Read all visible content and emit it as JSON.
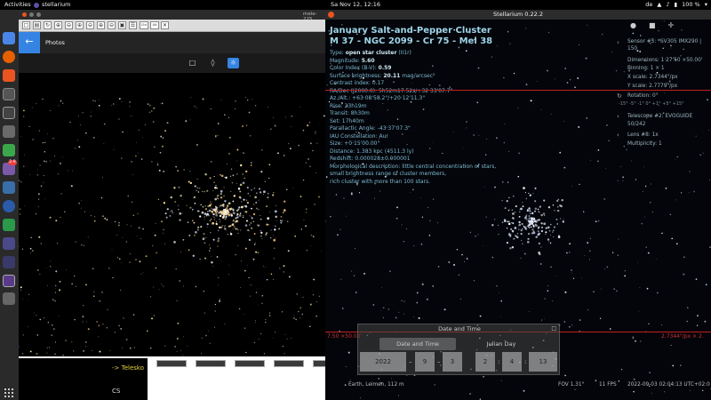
{
  "topbar": {
    "activities": "Activities",
    "app_name": "stellarium",
    "clock": "Sa Nov 12, 12:16",
    "lang": "de",
    "battery": "100 %"
  },
  "dock": {
    "badge_count": "2.9"
  },
  "viewer": {
    "title": "mele-225 [zoom",
    "toolbar_buttons": [
      "□",
      "▤",
      "↻",
      "⊕",
      "⊖",
      "⊕",
      "⊖",
      "⊕",
      "⊖",
      "▣",
      "☰",
      "Ctrl",
      "Alt",
      "✕"
    ],
    "photos_title": "Photos",
    "terminal_line": "-> Telesko",
    "terminal_prompt": "CS"
  },
  "stellarium": {
    "window_title": "Stellarium 0.22.2",
    "object_name_1": "January Salt-and-Pepper Cluster",
    "object_name_2": "M 37 - NGC 2099 - Cr 75 - Mel 38",
    "info_lines": [
      {
        "label": "Type: ",
        "value": "open star cluster",
        "tail": " (II1r)"
      },
      {
        "label": "Magnitude: ",
        "value": "5.60",
        "tail": ""
      },
      {
        "label": "Color Index (B-V): ",
        "value": "0.59",
        "tail": ""
      },
      {
        "label": "Surface brightness: ",
        "value": "20.11",
        "tail": " mag/arcsec²"
      },
      {
        "label": "Contrast index: 0.17",
        "value": "",
        "tail": ""
      },
      {
        "label": "RA/Dec (J2000.0): 5h52m17.52s/+32·33'07.7\"",
        "value": "",
        "tail": ""
      },
      {
        "label": "Az./Alt.:              +63·08'58.2\"/+20·12'11.3\"",
        "value": "",
        "tail": ""
      },
      {
        "label": "Rise:    23h19m",
        "value": "",
        "tail": ""
      },
      {
        "label": "Transit:  8h30m",
        "value": "",
        "tail": ""
      },
      {
        "label": "Set:      17h40m",
        "value": "",
        "tail": ""
      },
      {
        "label": "Parallactic Angle: -43·37'07.3\"",
        "value": "",
        "tail": ""
      },
      {
        "label": "IAU Constellation: Aur",
        "value": "",
        "tail": ""
      },
      {
        "label": "Size: +0·15'00.00\"",
        "value": "",
        "tail": ""
      },
      {
        "label": "Distance: 1.383 kpc (4511.3 ly)",
        "value": "",
        "tail": ""
      },
      {
        "label": "Redshift: 0.000028±0.000001",
        "value": "",
        "tail": ""
      },
      {
        "label": "Morphological description: little central concentration of stars,",
        "value": "",
        "tail": ""
      },
      {
        "label": "small brightness range of cluster members,",
        "value": "",
        "tail": ""
      },
      {
        "label": "rich cluster with more than 100 stars.",
        "value": "",
        "tail": ""
      }
    ],
    "ocular": {
      "sensor": "Sensor #5: *SV305 IMX290 |",
      "sensor_2": "150",
      "dimensions": "Dimensions: 1·27'50 ×50.00'",
      "binning": "Binning: 1 × 1",
      "x_scale": "X scale: 2.7344\"/px",
      "y_scale": "Y scale: 2.7779\"/px",
      "rotation": "Rotation: 0°",
      "rotation_scale": "-15° -5° -1°  0°  +1° +5° +15°",
      "telescope": "Telescope #2: EVOGUIDE",
      "telescope_2": "50/242",
      "lens": "Lens #8: 1x",
      "multiplicity": "Multiplicity: 1"
    },
    "red_left": "7.50 ×50.00'",
    "red_right": "2.7344\"/px × 2.",
    "datetime": {
      "dialog_title": "Date and Time",
      "tab_date": "Date and Time",
      "tab_julian": "Julian Day",
      "year": "2022",
      "month": "9",
      "day": "3",
      "hour": "2",
      "minute": "4",
      "second": "13"
    },
    "status": {
      "location": "Earth, Leimen, 112 m",
      "fov": "FOV 1.31°",
      "fps": "11 FPS",
      "time": "2022-09-03 02:04:13 UTC+02:0"
    }
  }
}
